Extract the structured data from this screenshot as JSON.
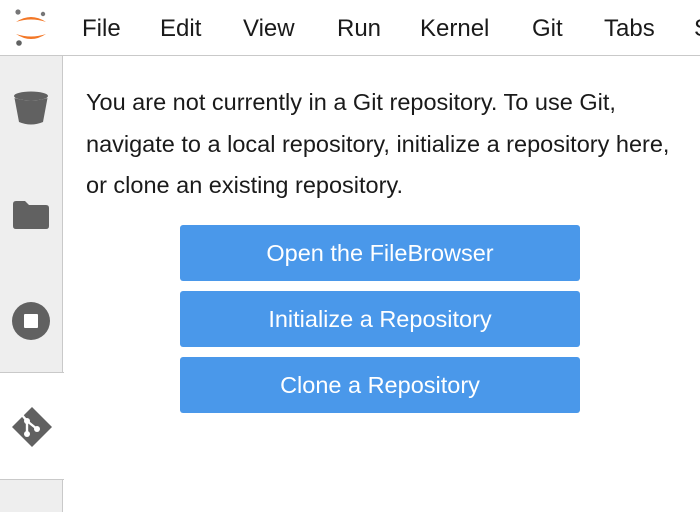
{
  "menubar": {
    "logo_icon": "jupyter-logo-icon",
    "items": [
      "File",
      "Edit",
      "View",
      "Run",
      "Kernel",
      "Git",
      "Tabs",
      "S"
    ]
  },
  "sidebar": {
    "icons": [
      "trash-bucket-icon",
      "folder-icon",
      "stop-circle-icon",
      "git-icon"
    ],
    "active": "git-icon"
  },
  "git_panel": {
    "message": "You are not currently in a Git repository. To use Git, navigate to a local repository, initialize a repository here, or clone an existing repository.",
    "buttons": {
      "open_filebrowser": "Open the FileBrowser",
      "initialize": "Initialize a Repository",
      "clone": "Clone a Repository"
    }
  },
  "colors": {
    "button_bg": "#4a98ea",
    "jupyter_orange": "#f37726",
    "icon_gray": "#616161",
    "sidebar_bg": "#eeeeee"
  }
}
